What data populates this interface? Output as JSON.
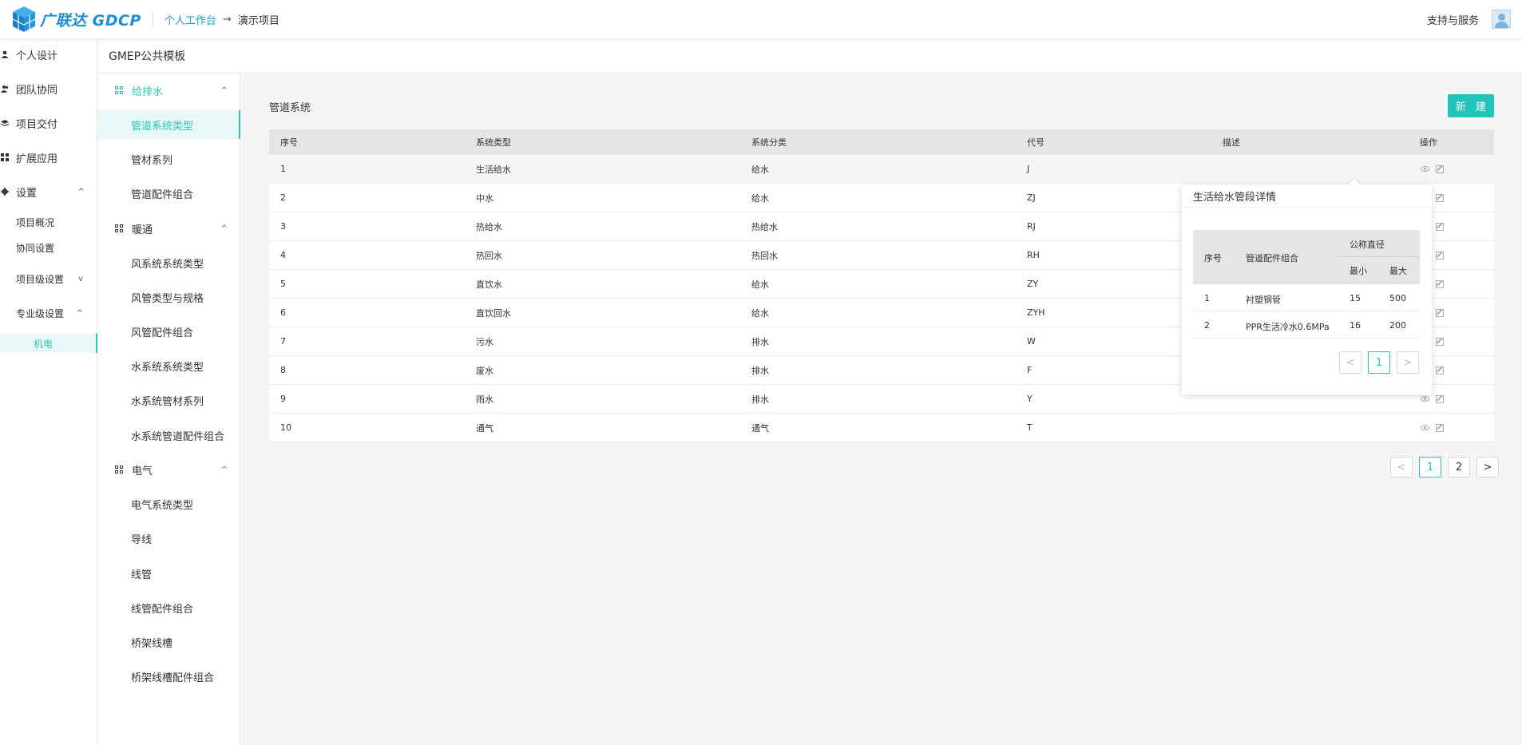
{
  "header": {
    "logo_text": "广联达",
    "logo_text_en": "GDCP",
    "breadcrumb_1": "个人工作台",
    "breadcrumb_2": "演示项目",
    "support": "支持与服务"
  },
  "sidebar1": {
    "items": [
      {
        "label": "个人设计"
      },
      {
        "label": "团队协同"
      },
      {
        "label": "项目交付"
      },
      {
        "label": "扩展应用"
      },
      {
        "label": "设置"
      }
    ],
    "settings_sub": {
      "overview": "项目概况",
      "collab": "协同设置",
      "project_level": "项目级设置",
      "pro_level": "专业级设置",
      "mech": "机电"
    }
  },
  "page_title": "GMEP公共模板",
  "sidebar2": {
    "groups": [
      {
        "label": "给排水",
        "items": [
          "管道系统类型",
          "管材系列",
          "管道配件组合"
        ]
      },
      {
        "label": "暖通",
        "items": [
          "风系统系统类型",
          "风管类型与规格",
          "风管配件组合",
          "水系统系统类型",
          "水系统管材系列",
          "水系统管道配件组合"
        ]
      },
      {
        "label": "电气",
        "items": [
          "电气系统类型",
          "导线",
          "线管",
          "线管配件组合",
          "桥架线槽",
          "桥架线槽配件组合"
        ]
      }
    ]
  },
  "main": {
    "section_title": "管道系统",
    "new_button": "新 建",
    "columns": [
      "序号",
      "系统类型",
      "系统分类",
      "代号",
      "描述",
      "操作"
    ],
    "rows": [
      [
        "1",
        "生活给水",
        "给水",
        "J"
      ],
      [
        "2",
        "中水",
        "给水",
        "ZJ"
      ],
      [
        "3",
        "热给水",
        "热给水",
        "RJ"
      ],
      [
        "4",
        "热回水",
        "热回水",
        "RH"
      ],
      [
        "5",
        "直饮水",
        "给水",
        "ZY"
      ],
      [
        "6",
        "直饮回水",
        "给水",
        "ZYH"
      ],
      [
        "7",
        "污水",
        "排水",
        "W"
      ],
      [
        "8",
        "废水",
        "排水",
        "F"
      ],
      [
        "9",
        "雨水",
        "排水",
        "Y"
      ],
      [
        "10",
        "通气",
        "通气",
        "T"
      ]
    ],
    "pager": {
      "prev": "<",
      "pages": [
        "1",
        "2"
      ],
      "next": ">",
      "current": "1"
    }
  },
  "popover": {
    "title": "生活给水管段详情",
    "col_index": "序号",
    "col_combo": "管道配件组合",
    "col_diameter": "公称直径",
    "col_min": "最小",
    "col_max": "最大",
    "rows": [
      [
        "1",
        "衬塑钢管",
        "15",
        "500"
      ],
      [
        "2",
        "PPR生活冷水0.6MPa",
        "16",
        "200"
      ]
    ],
    "pager": {
      "prev": "<",
      "page": "1",
      "next": ">"
    }
  }
}
